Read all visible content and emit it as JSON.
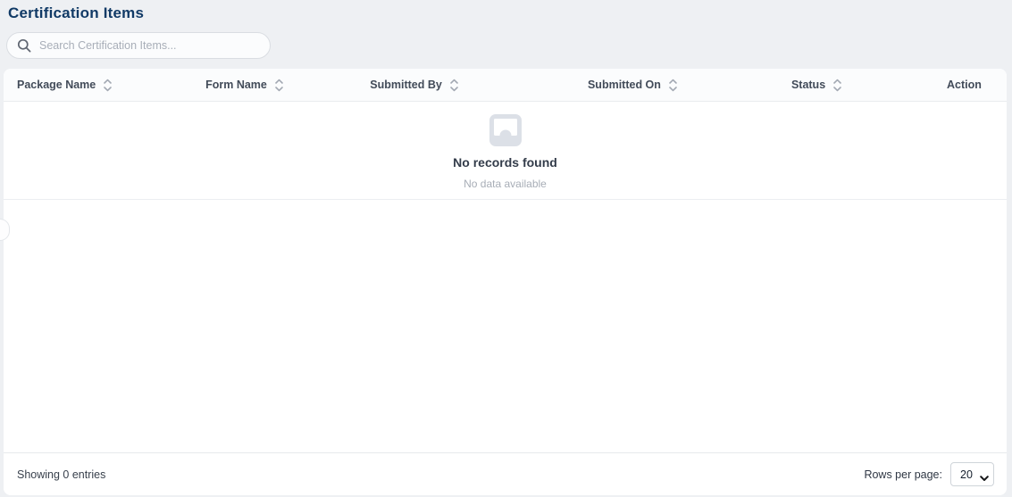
{
  "page": {
    "title": "Certification Items"
  },
  "search": {
    "placeholder": "Search Certification Items...",
    "value": ""
  },
  "table": {
    "columns": [
      {
        "label": "Package Name",
        "sortable": true
      },
      {
        "label": "Form Name",
        "sortable": true
      },
      {
        "label": "Submitted By",
        "sortable": true
      },
      {
        "label": "Submitted On",
        "sortable": true
      },
      {
        "label": "Status",
        "sortable": true
      },
      {
        "label": "Action",
        "sortable": false
      }
    ],
    "rows": [],
    "empty_state": {
      "title": "No records found",
      "subtitle": "No data available"
    }
  },
  "pagination": {
    "summary": "Showing 0 entries",
    "rows_per_page_label": "Rows per page:",
    "rows_per_page_value": "20"
  },
  "icons": {
    "search_icon": "magnifier",
    "sort_icon": "chevron-up-down",
    "empty_icon": "inbox-tray",
    "select_chevron_icon": "chevron-down",
    "drawer_handle": "collapsed-panel-tab"
  },
  "colors": {
    "title_navy": "#113a66",
    "page_background": "#eef0f3",
    "card_background": "#ffffff",
    "header_row_background": "#fbfcfd",
    "divider": "#e9ecef",
    "header_text": "#424b59",
    "muted_text": "#a7adb6",
    "empty_icon_gray": "#dce0e7"
  }
}
